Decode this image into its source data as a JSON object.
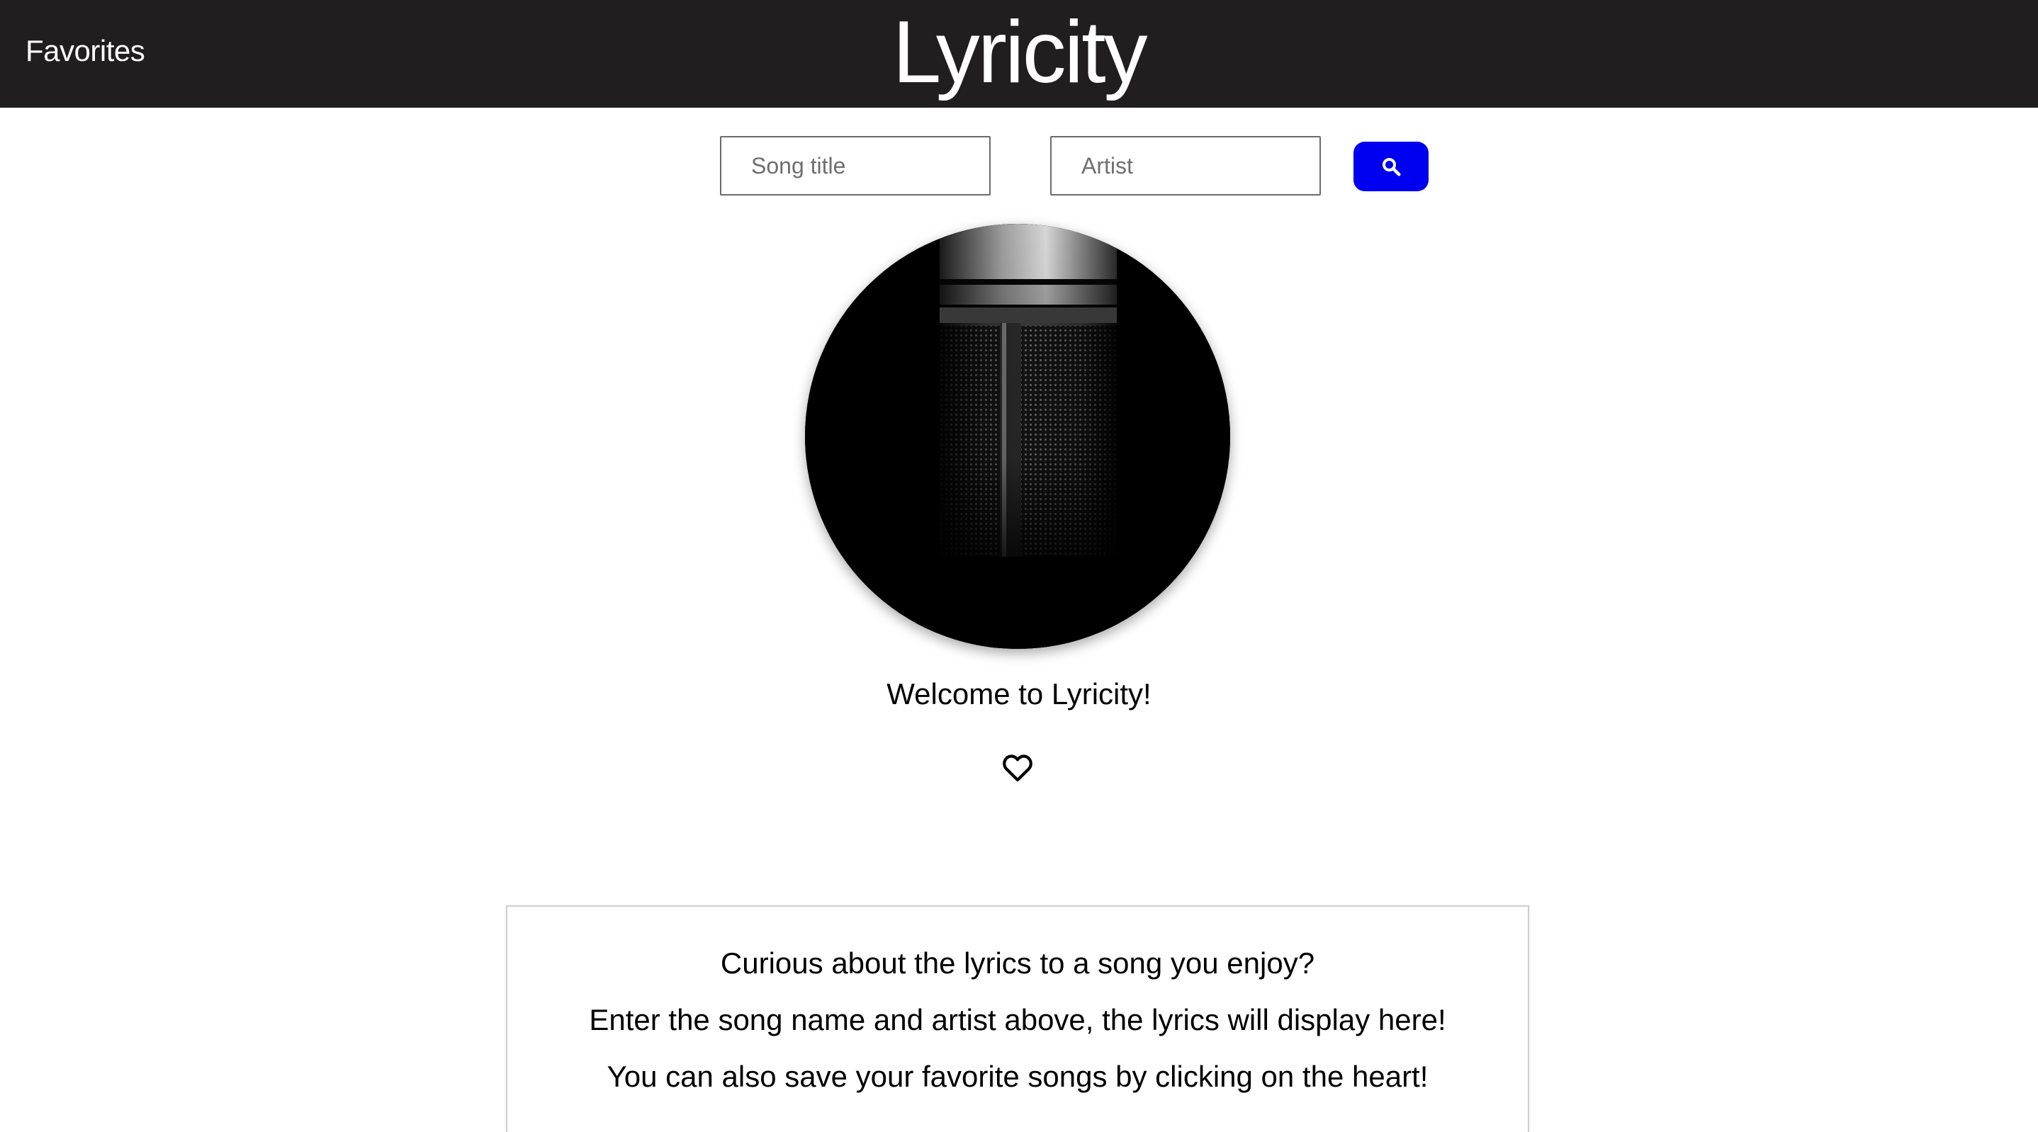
{
  "nav": {
    "favorites_label": "Favorites",
    "brand": "Lyricity"
  },
  "search": {
    "song_placeholder": "Song title",
    "artist_placeholder": "Artist",
    "song_value": "",
    "artist_value": "",
    "button_icon": "search-icon",
    "button_color": "#0000f0"
  },
  "hero": {
    "image": "microphone-image"
  },
  "welcome": {
    "heading": "Welcome to Lyricity!",
    "favorite_icon": "heart-outline-icon"
  },
  "info": {
    "lines": [
      "Curious about the lyrics to a song you enjoy?",
      "Enter the song name and artist above, the lyrics will display here!",
      "You can also save your favorite songs by clicking on the heart!"
    ]
  },
  "colors": {
    "header_bg": "#201e1f",
    "accent": "#0000f0"
  }
}
